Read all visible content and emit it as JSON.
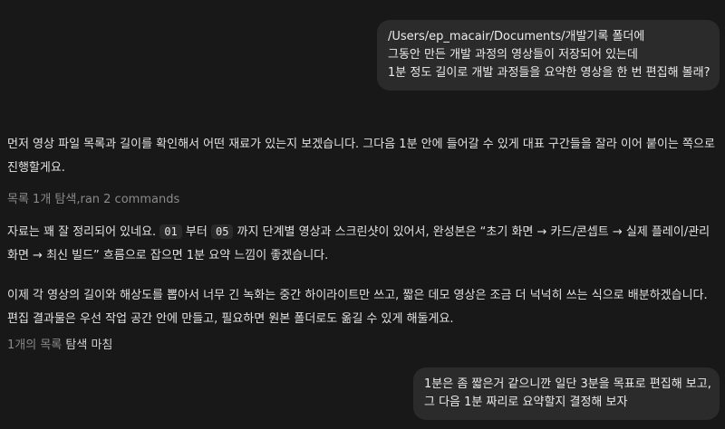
{
  "messages": {
    "user_1": {
      "lines": [
        "/Users/ep_macair/Documents/개발기록 폴더에",
        "그동안 만든 개발 과정의 영상들이 저장되어 있는데",
        "1분 정도 길이로 개발 과정들을 요약한 영상을 한 번 편집해 볼래?"
      ]
    },
    "assistant_1": {
      "text": "먼저 영상 파일 목록과 길이를 확인해서 어떤 재료가 있는지 보겠습니다. 그다음 1분 안에 들어갈 수 있게 대표 구간들을 잘라 이어 붙이는 쪽으로 진행할게요."
    },
    "status_1": {
      "text": "목록 1개 탐색,ran 2 commands"
    },
    "assistant_2": {
      "prefix": "자료는 꽤 잘 정리되어 있네요. ",
      "code_a": "01",
      "mid": " 부터 ",
      "code_b": "05",
      "suffix": " 까지 단계별 영상과 스크린샷이 있어서, 완성본은 “초기 화면 → 카드/콘셉트 → 실제 플레이/관리 화면 → 최신 빌드” 흐름으로 잡으면 1분 요약 느낌이 좋겠습니다."
    },
    "assistant_3": {
      "text": "이제 각 영상의 길이와 해상도를 뽑아서 너무 긴 녹화는 중간 하이라이트만 쓰고, 짧은 데모 영상은 조금 더 넉넉히 쓰는 식으로 배분하겠습니다. 편집 결과물은 우선 작업 공간 안에 만들고, 필요하면 원본 폴더로도 옮길 수 있게 해둘게요."
    },
    "status_2": {
      "prefix": "1개의 목록 ",
      "strong": "탐색 마침"
    },
    "user_2": {
      "lines": [
        "1분은 좀 짧은거 같으니깐 일단 3분을 목표로 편집해 보고,",
        "그 다음 1분 짜리로 요약할지 결정해 보자"
      ]
    }
  },
  "colors": {
    "background": "#181818",
    "bubble": "#2b2b2b",
    "text": "#e3e3e3",
    "muted": "#8a8a8a"
  }
}
